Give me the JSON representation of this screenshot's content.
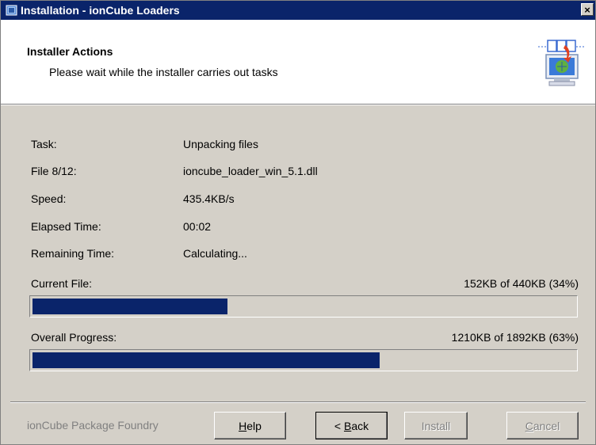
{
  "window": {
    "title": "Installation - ionCube Loaders",
    "close_symbol": "×"
  },
  "header": {
    "title": "Installer Actions",
    "subtitle": "Please wait while the installer carries out tasks",
    "icon": "installer-computer-icon"
  },
  "details": [
    {
      "label": "Task:",
      "value": "Unpacking files"
    },
    {
      "label": "File 8/12:",
      "value": "ioncube_loader_win_5.1.dll"
    },
    {
      "label": "Speed:",
      "value": "435.4KB/s"
    },
    {
      "label": "Elapsed Time:",
      "value": "00:02"
    },
    {
      "label": "Remaining Time:",
      "value": "Calculating..."
    }
  ],
  "current_file": {
    "label": "Current File:",
    "status": "152KB of 440KB (34%)",
    "progress": 0.36
  },
  "overall": {
    "label": "Overall Progress:",
    "status": "1210KB of 1892KB (63%)",
    "progress": 0.64
  },
  "footer": {
    "brand": "ionCube Package Foundry",
    "buttons": {
      "help": {
        "accel": "H",
        "rest": "elp",
        "enabled": true
      },
      "back": {
        "prefix": "< ",
        "accel": "B",
        "rest": "ack",
        "enabled": true
      },
      "install": {
        "label": "Install",
        "enabled": false
      },
      "cancel": {
        "accel": "C",
        "rest": "ancel",
        "enabled": false
      }
    }
  },
  "colors": {
    "titlebar": "#0a246a",
    "progress_fill": "#0a246a",
    "window_face": "#d4d0c8"
  }
}
